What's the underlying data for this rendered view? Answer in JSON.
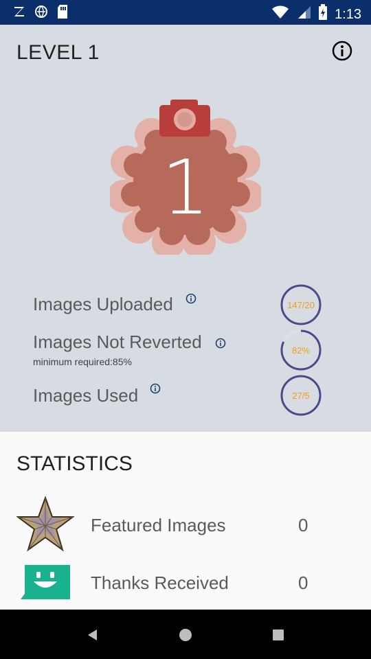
{
  "status_bar": {
    "time": "1:13"
  },
  "header": {
    "level_title": "LEVEL 1"
  },
  "badge": {
    "level_number": "1"
  },
  "metrics": [
    {
      "label": "Images Uploaded",
      "ring_text": "147/20",
      "progress": 1.0
    },
    {
      "label": "Images Not Reverted",
      "sublabel": "minimum required:85%",
      "ring_text": "82%",
      "progress": 0.82
    },
    {
      "label": "Images Used",
      "ring_text": "27/5",
      "progress": 1.0
    }
  ],
  "statistics": {
    "title": "STATISTICS",
    "items": [
      {
        "label": "Featured Images",
        "value": "0",
        "icon": "featured-star-icon"
      },
      {
        "label": "Thanks Received",
        "value": "0",
        "icon": "thanks-smiley-icon"
      }
    ]
  },
  "colors": {
    "status_bar": "#0b2f6b",
    "top_bg": "#d7dce2",
    "badge_outer": "#e3b1a8",
    "badge_inner": "#b86a5a",
    "camera": "#b73e3b",
    "ring_track": "#4a4a8a",
    "ring_text": "#f29b1e",
    "thanks_green": "#19b28e"
  }
}
